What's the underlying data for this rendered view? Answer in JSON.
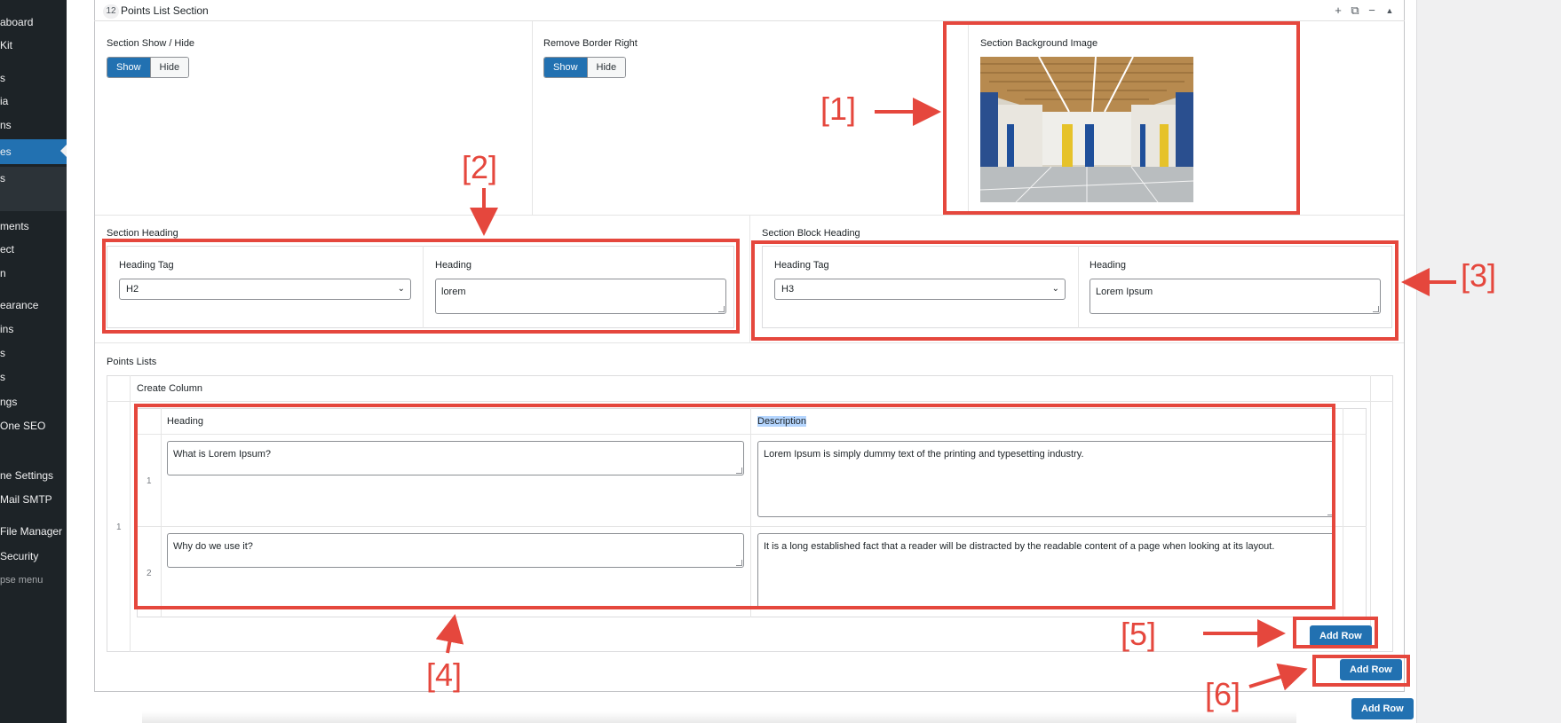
{
  "sidebar": {
    "items": [
      {
        "label": "aboard",
        "active": false
      },
      {
        "label": "Kit",
        "active": false
      },
      {
        "label": "s",
        "active": false
      },
      {
        "label": "ia",
        "active": false
      },
      {
        "label": "ns",
        "active": false
      },
      {
        "label": "es",
        "active": true
      },
      {
        "label": "s",
        "active": false
      },
      {
        "label": "ments",
        "active": false
      },
      {
        "label": "ect",
        "active": false
      },
      {
        "label": "n",
        "active": false
      },
      {
        "label": "earance",
        "active": false
      },
      {
        "label": "ins",
        "active": false
      },
      {
        "label": "s",
        "active": false
      },
      {
        "label": "s",
        "active": false
      },
      {
        "label": "ngs",
        "active": false
      },
      {
        "label": " One SEO",
        "active": false
      },
      {
        "label": "ne Settings",
        "active": false
      },
      {
        "label": "Mail SMTP",
        "active": false
      },
      {
        "label": "File Manager",
        "active": false
      },
      {
        "label": "Security",
        "active": false
      },
      {
        "label": "pse menu",
        "active": false
      }
    ]
  },
  "postbox": {
    "badge": "12",
    "title": "Points List Section"
  },
  "fields": {
    "section_show_hide": {
      "label": "Section Show / Hide",
      "options": [
        "Show",
        "Hide"
      ],
      "selected": "Show"
    },
    "remove_border_right": {
      "label": "Remove Border Right",
      "options": [
        "Show",
        "Hide"
      ],
      "selected": "Show"
    },
    "section_bg_image": {
      "label": "Section Background Image"
    },
    "section_heading": {
      "label": "Section Heading",
      "tag_label": "Heading Tag",
      "tag_value": "H2",
      "heading_label": "Heading",
      "heading_value": "lorem"
    },
    "section_block_heading": {
      "label": "Section Block Heading",
      "tag_label": "Heading Tag",
      "tag_value": "H3",
      "heading_label": "Heading",
      "heading_value": "Lorem Ipsum"
    },
    "points_lists": {
      "label": "Points Lists",
      "create_column_label": "Create Column",
      "outer_row_index": "1",
      "columns": [
        "Heading",
        "Description"
      ],
      "rows": [
        {
          "index": "1",
          "heading": "What is Lorem Ipsum?",
          "description": "Lorem Ipsum is simply dummy text of the printing and typesetting industry."
        },
        {
          "index": "2",
          "heading": "Why do we use it?",
          "description": "It is a long established fact that a reader will be distracted by the readable content of a page when looking at its layout."
        }
      ],
      "add_row_inner": "Add Row",
      "add_row_outer": "Add Row"
    },
    "add_row_page": "Add Row"
  },
  "annotations": {
    "labels": [
      "[1]",
      "[2]",
      "[3]",
      "[4]",
      "[5]",
      "[6]"
    ],
    "color": "#e5473d"
  },
  "colors": {
    "accent": "#2271b1",
    "sidebar_bg": "#1d2327"
  }
}
